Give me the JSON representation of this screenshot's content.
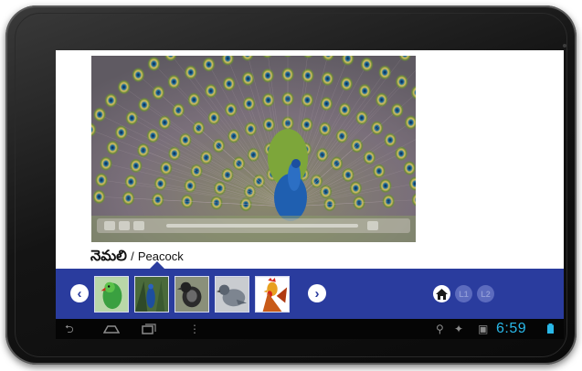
{
  "caption": {
    "telugu": "నెమలి",
    "separator": "/",
    "english": "Peacock"
  },
  "thumbnails": [
    {
      "name": "parrot-thumbnail",
      "colors": [
        "#2e8a3a",
        "#5cc24a",
        "#c4301f"
      ]
    },
    {
      "name": "peacock-thumbnail",
      "colors": [
        "#3b5a2e",
        "#1d4e9e",
        "#8a9a5c"
      ]
    },
    {
      "name": "crow-thumbnail",
      "colors": [
        "#6a6a5e",
        "#2b2b2b",
        "#9aa07a"
      ]
    },
    {
      "name": "pigeon-thumbnail",
      "colors": [
        "#c9ccd0",
        "#7d8590",
        "#5b6470"
      ]
    },
    {
      "name": "rooster-thumbnail",
      "colors": [
        "#ffffff",
        "#d8281c",
        "#e8a020"
      ]
    }
  ],
  "level_buttons": {
    "l1": "L1",
    "l2": "L2"
  },
  "status": {
    "time": "6:59"
  },
  "colors": {
    "bar": "#2a3c9e",
    "clock": "#29b8e8"
  }
}
